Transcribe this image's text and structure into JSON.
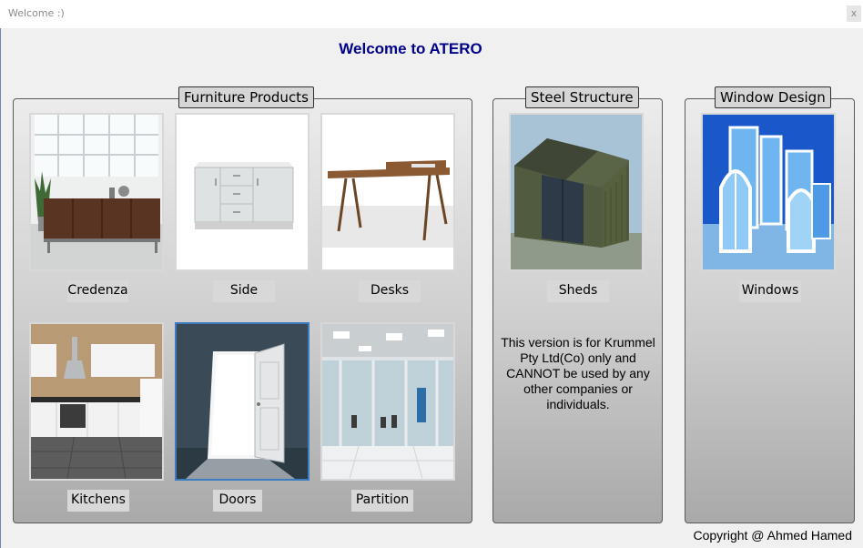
{
  "window": {
    "title": "Welcome :)",
    "close_glyph": "x"
  },
  "header": {
    "heading": "Welcome to ATERO"
  },
  "furniture": {
    "legend": "Furniture Products",
    "items": [
      {
        "label": "Credenza",
        "image": "credenza-photo"
      },
      {
        "label": "Side",
        "image": "side-cabinet-photo"
      },
      {
        "label": "Desks",
        "image": "desk-photo"
      },
      {
        "label": "Kitchens",
        "image": "kitchen-photo"
      },
      {
        "label": "Doors",
        "image": "door-photo",
        "selected": true
      },
      {
        "label": "Partition",
        "image": "glass-partition-photo"
      }
    ]
  },
  "steel": {
    "legend": "Steel Structure",
    "items": [
      {
        "label": "Sheds",
        "image": "steel-shed-photo"
      }
    ],
    "notice": "This version is for Krummel Pty Ltd(Co) only and CANNOT be used by any other companies or individuals."
  },
  "window_design": {
    "legend": "Window Design",
    "items": [
      {
        "label": "Windows",
        "image": "windows-photo"
      }
    ]
  },
  "footer": {
    "copyright": "Copyright @ Ahmed Hamed"
  },
  "colors": {
    "heading": "#00008b",
    "selection": "#3b7bbf",
    "panel_border": "#5a5a5a"
  }
}
